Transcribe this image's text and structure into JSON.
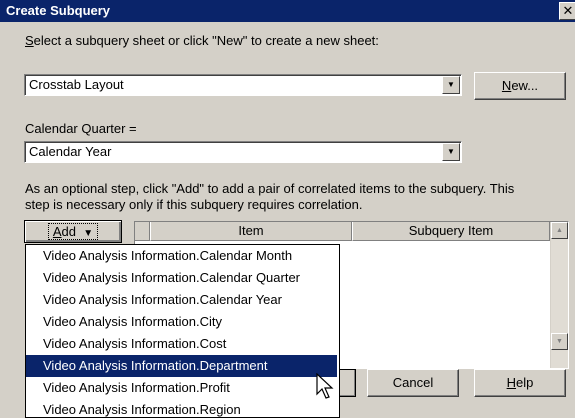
{
  "window": {
    "title": "Create Subquery",
    "close_glyph": "✕"
  },
  "sheet": {
    "prompt_accel": "S",
    "prompt_rest": "elect a subquery sheet or click \"New\" to create a new sheet:",
    "selected": "Crosstab Layout",
    "new_accel": "N",
    "new_rest": "ew..."
  },
  "quarter": {
    "label": "Calendar Quarter =",
    "selected": "Calendar Year"
  },
  "instructions": {
    "line1": "As an optional step, click \"Add\" to add a pair of correlated items to the subquery.  This",
    "line2": "step is necessary only if this subquery requires correlation."
  },
  "add_button": {
    "accel": "A",
    "rest": "dd",
    "arrow": "▼"
  },
  "grid": {
    "columns": [
      "Item",
      "Subquery Item"
    ],
    "scroll_up": "▲",
    "scroll_down": "▼"
  },
  "dropdown": {
    "items": [
      "Video Analysis Information.Calendar Month",
      "Video Analysis Information.Calendar Quarter",
      "Video Analysis Information.Calendar Year",
      "Video Analysis Information.City",
      "Video Analysis Information.Cost",
      "Video Analysis Information.Department",
      "Video Analysis Information.Profit",
      "Video Analysis Information.Region"
    ],
    "selected_index": 5
  },
  "footer": {
    "cancel": "Cancel",
    "help_accel": "H",
    "help_rest": "elp"
  },
  "colors": {
    "titlebar": "#0a246a",
    "face": "#d4d0c8",
    "selection": "#0a246a"
  }
}
